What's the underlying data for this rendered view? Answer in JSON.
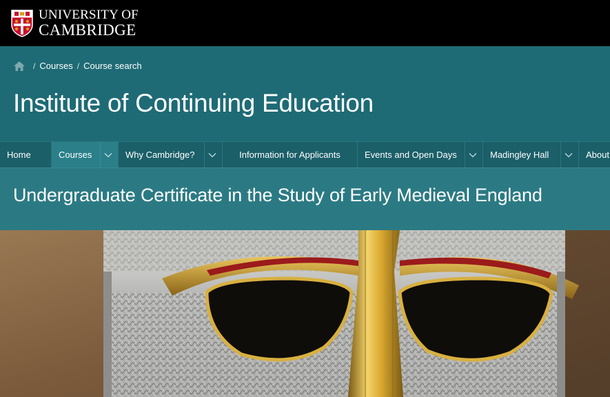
{
  "brand": {
    "line1": "UNIVERSITY OF",
    "line2": "CAMBRIDGE"
  },
  "breadcrumb": {
    "items": [
      "Courses",
      "Course search"
    ],
    "separator": "/"
  },
  "site": {
    "title": "Institute of Continuing Education"
  },
  "nav": {
    "items": [
      {
        "label": "Home",
        "has_menu": false,
        "active": false
      },
      {
        "label": "Courses",
        "has_menu": true,
        "active": true
      },
      {
        "label": "Why Cambridge?",
        "has_menu": true,
        "active": false
      },
      {
        "label": "Information for Applicants",
        "has_menu": false,
        "active": false
      },
      {
        "label": "Events and Open Days",
        "has_menu": true,
        "active": false
      },
      {
        "label": "Madingley Hall",
        "has_menu": true,
        "active": false
      },
      {
        "label": "About",
        "has_menu": false,
        "active": false
      }
    ]
  },
  "page": {
    "title": "Undergraduate Certificate in the Study of Early Medieval England"
  },
  "hero": {
    "icon": "sutton-hoo-helmet-image"
  },
  "colors": {
    "topbar": "#000000",
    "header": "#1e6b75",
    "nav": "#1b5f69",
    "nav_active": "#2a7f89",
    "page_band": "#2b7a83"
  }
}
